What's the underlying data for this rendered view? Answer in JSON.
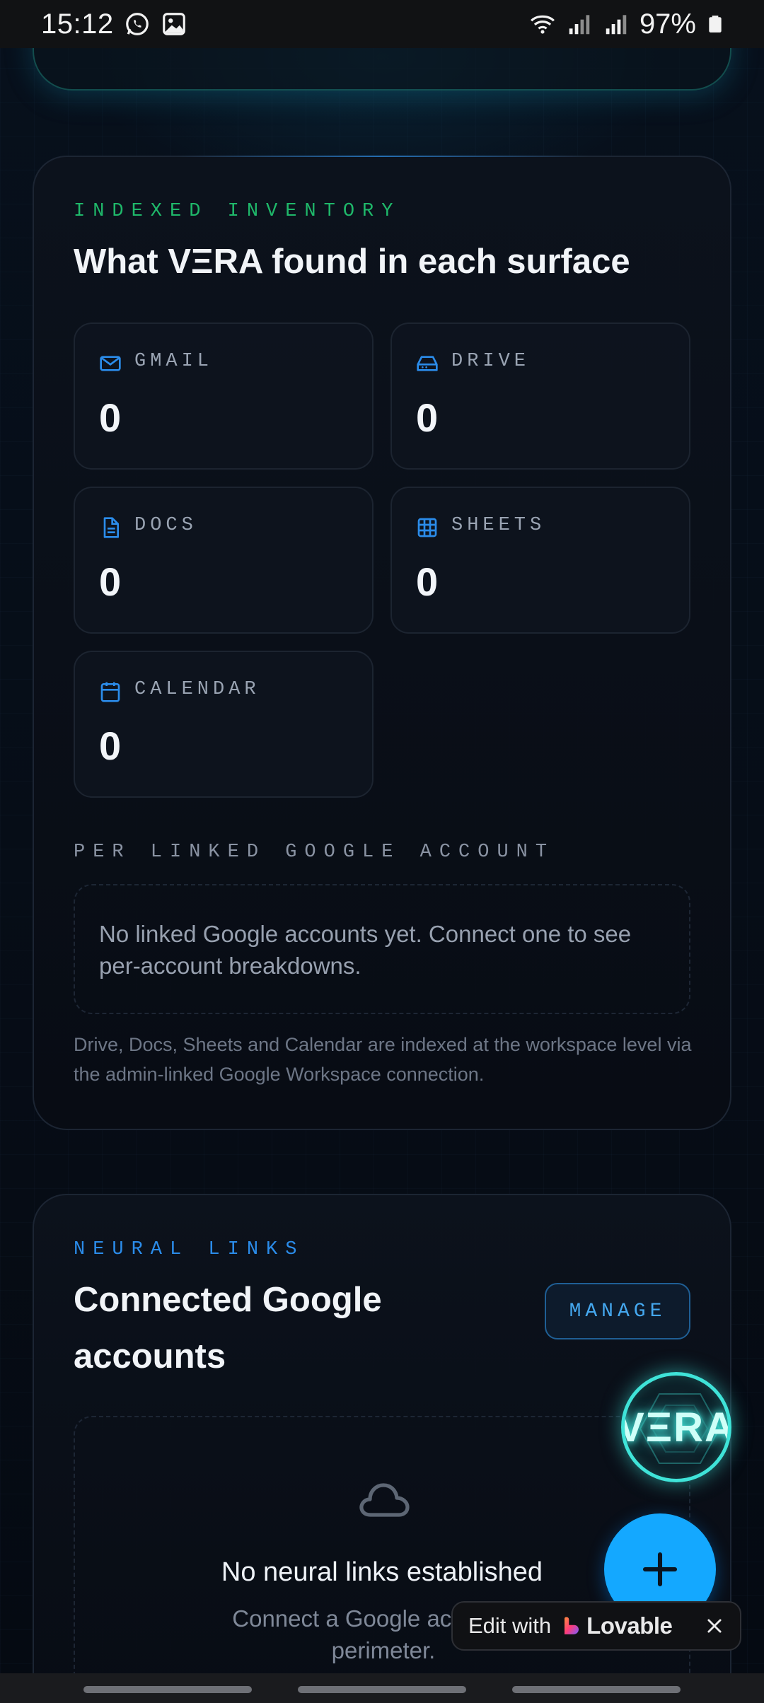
{
  "status_bar": {
    "time": "15:12",
    "battery": "97%",
    "icons": [
      "whatsapp-icon",
      "gallery-icon",
      "wifi-icon",
      "signal-icon",
      "signal-icon",
      "battery-icon"
    ]
  },
  "inventory": {
    "eyebrow": "INDEXED INVENTORY",
    "title": "What VΞRA found in each surface",
    "stats": [
      {
        "label": "GMAIL",
        "value": "0",
        "icon": "mail-icon"
      },
      {
        "label": "DRIVE",
        "value": "0",
        "icon": "drive-icon"
      },
      {
        "label": "DOCS",
        "value": "0",
        "icon": "document-icon"
      },
      {
        "label": "SHEETS",
        "value": "0",
        "icon": "table-icon"
      },
      {
        "label": "CALENDAR",
        "value": "0",
        "icon": "calendar-icon"
      }
    ],
    "per_account_heading": "PER LINKED GOOGLE ACCOUNT",
    "per_account_empty": "No linked Google accounts yet. Connect one to see per-account breakdowns.",
    "footnote": "Drive, Docs, Sheets and Calendar are indexed at the workspace level via the admin-linked Google Workspace connection.",
    "accent_color": "#1fb86a",
    "icon_color": "#2b8cea"
  },
  "neural_links": {
    "eyebrow": "NEURAL LINKS",
    "title": "Connected Google accounts",
    "manage_label": "MANAGE",
    "empty_title": "No neural links established",
    "empty_subtitle_line1": "Connect a Google account to",
    "empty_subtitle_line2": "perimeter.",
    "accent_color": "#2b8cea"
  },
  "floating": {
    "orb_text": "VΞRA",
    "fab_icon": "plus-icon",
    "fab_color": "#14a8ff",
    "lovable_edit": "Edit with",
    "lovable_brand": "Lovable"
  }
}
